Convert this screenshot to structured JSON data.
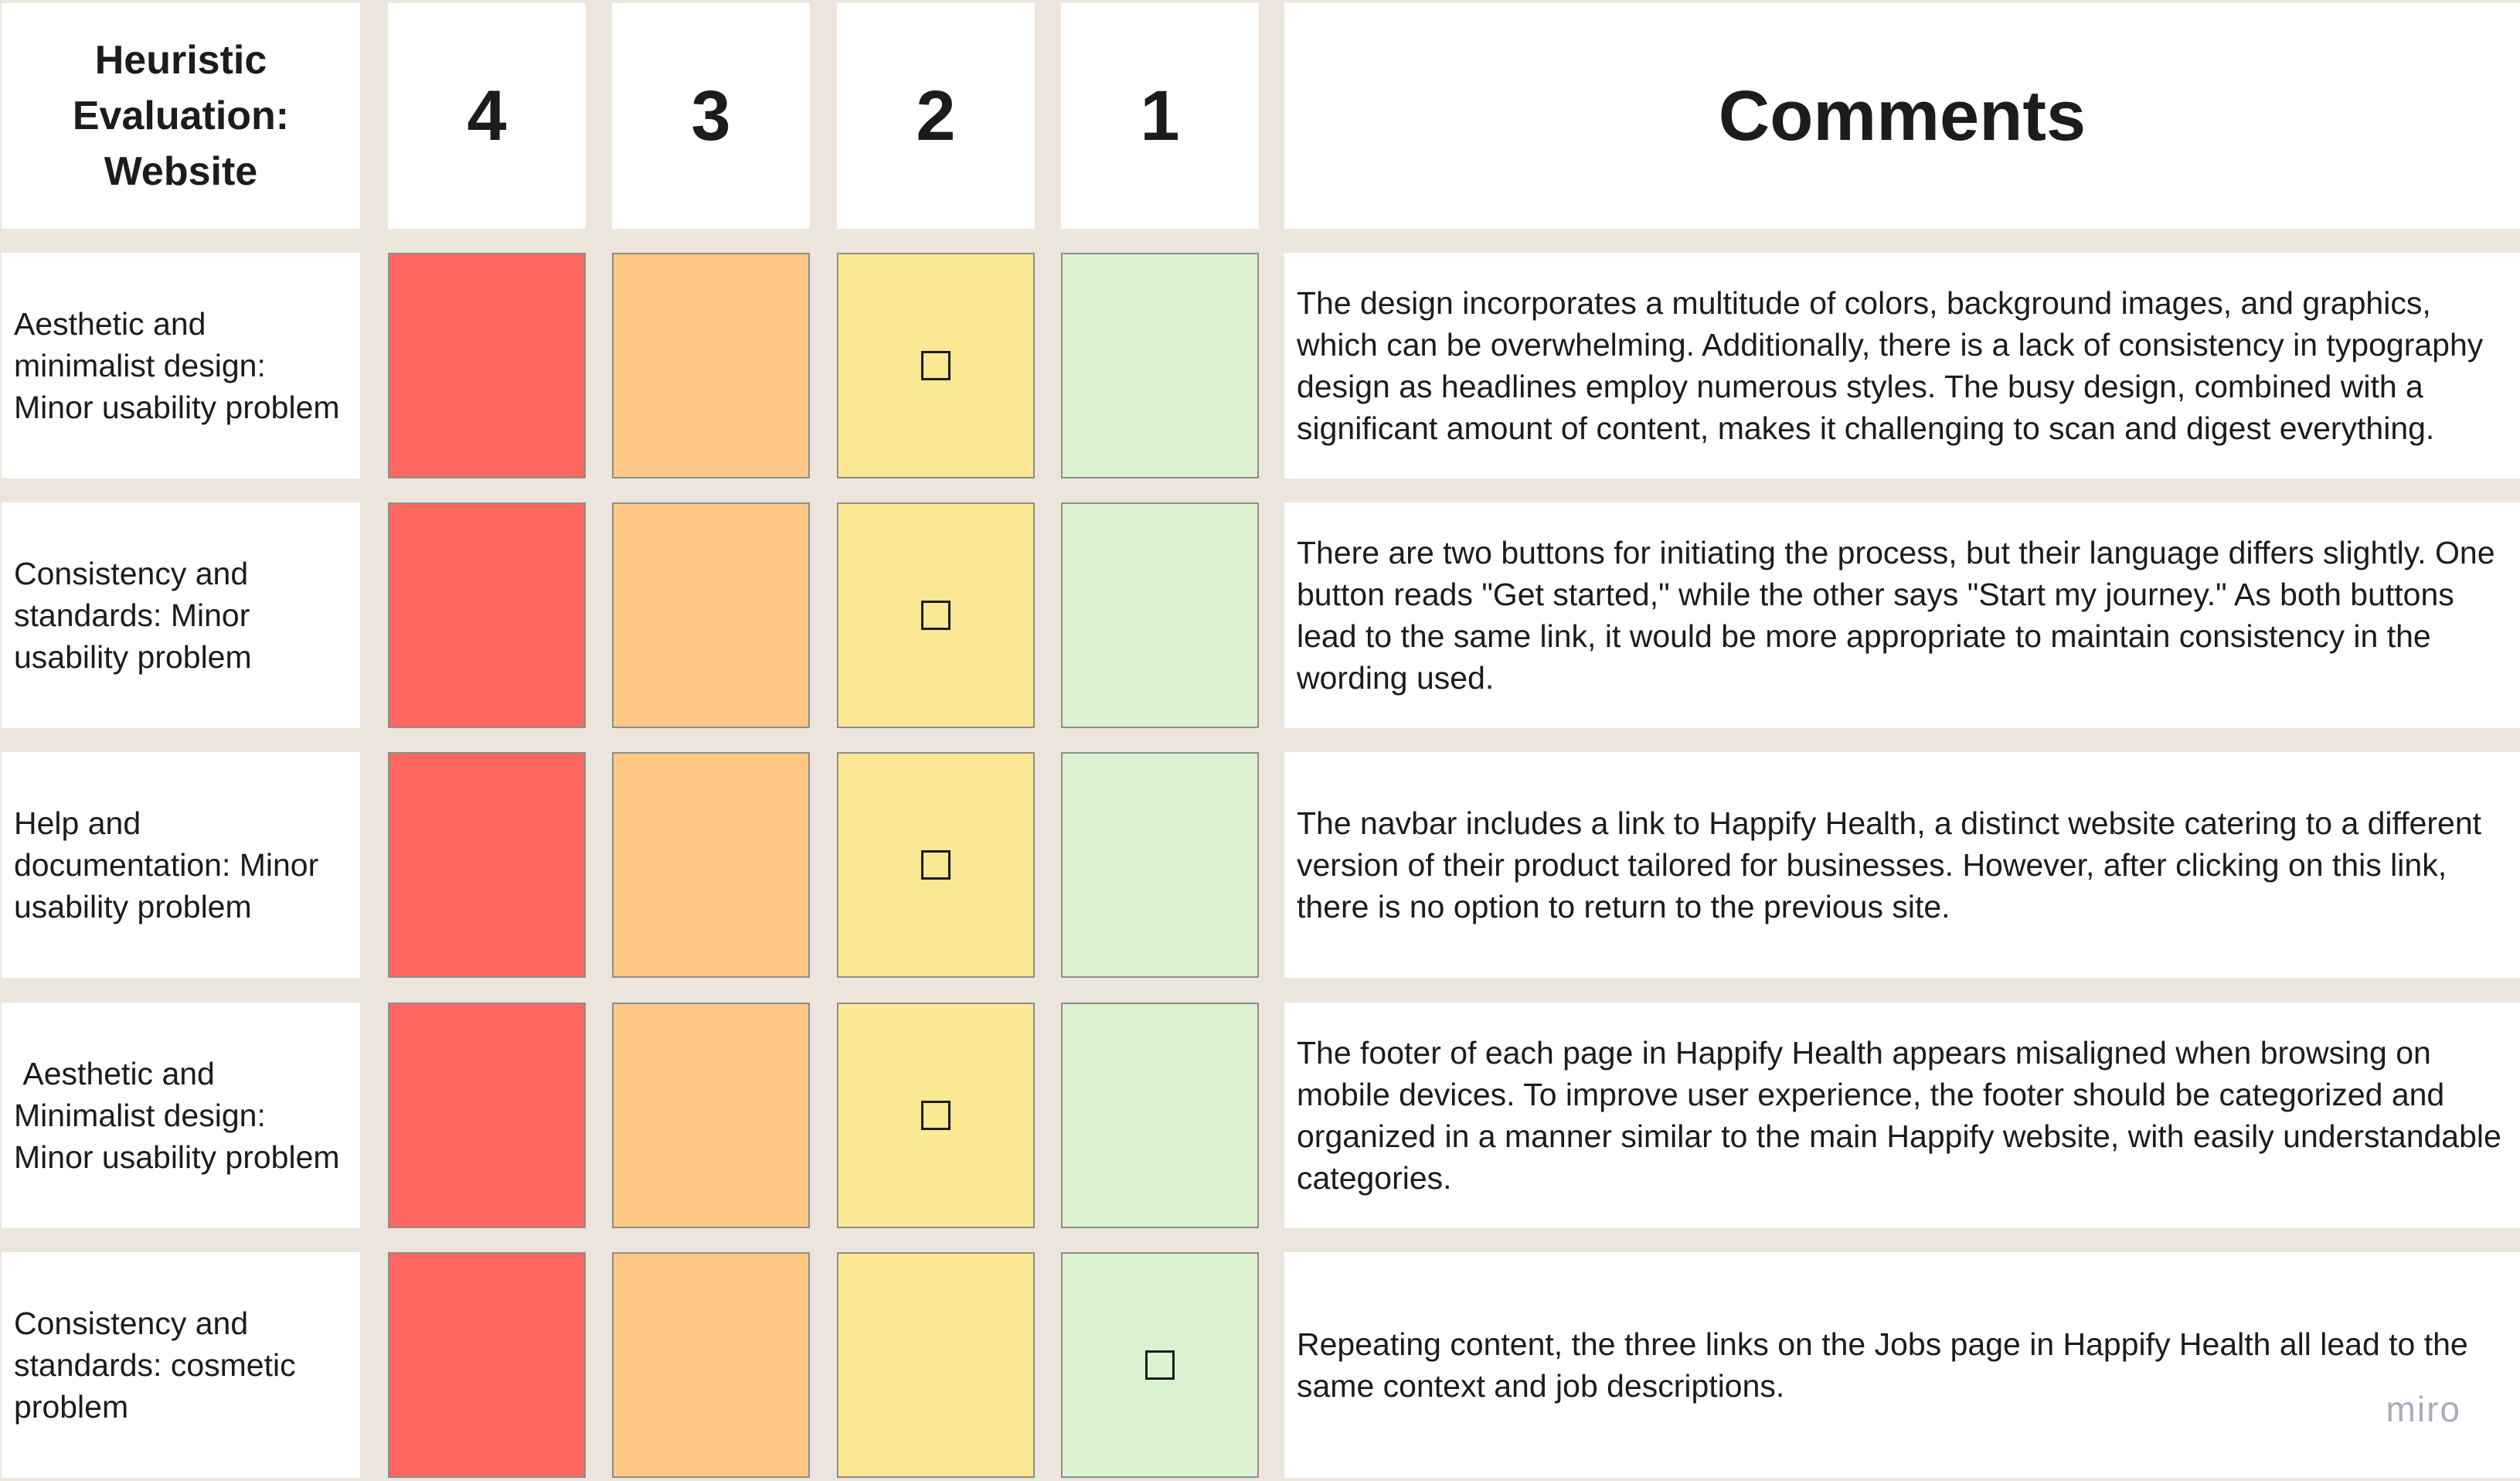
{
  "header": {
    "title": "Heuristic Evaluation: Website",
    "scores": [
      "4",
      "3",
      "2",
      "1"
    ],
    "comments": "Comments"
  },
  "severity_colors": {
    "4": "#ff6761",
    "3": "#ffc783",
    "2": "#fbe794",
    "1": "#dcf1d0"
  },
  "rows": [
    {
      "label": "Aesthetic and minimalist design: Minor usability problem",
      "selected": "2",
      "comment": "The design incorporates a multitude of colors, background images, and graphics, which can be overwhelming. Additionally, there is a lack of consistency in typography design as headlines employ numerous styles. The busy design, combined with a significant amount of content, makes it challenging to scan and digest everything."
    },
    {
      "label": "Consistency and standards: Minor usability problem",
      "selected": "2",
      "comment": "There are two buttons for initiating the process, but their language differs slightly. One button reads \"Get started,\" while the other says \"Start my journey.\" As both buttons lead to the same link, it would be more appropriate to maintain consistency in the wording used."
    },
    {
      "label": "Help and documentation: Minor usability problem",
      "selected": "2",
      "comment": "The navbar includes a link to Happify Health, a distinct website catering to a different version of their product tailored for businesses. However, after clicking on this link, there is no option to return to the previous site."
    },
    {
      "label": " Aesthetic and Minimalist design: Minor usability problem",
      "selected": "2",
      "comment": "The footer of each page in Happify Health appears misaligned when browsing on mobile devices. To improve user experience, the footer should be categorized and organized in a manner similar to the main Happify website, with easily understandable categories."
    },
    {
      "label": "Consistency and standards: cosmetic problem",
      "selected": "1",
      "comment": "Repeating content, the three links on the Jobs page in Happify Health all lead to the same context and job descriptions."
    }
  ],
  "watermark": "miro"
}
